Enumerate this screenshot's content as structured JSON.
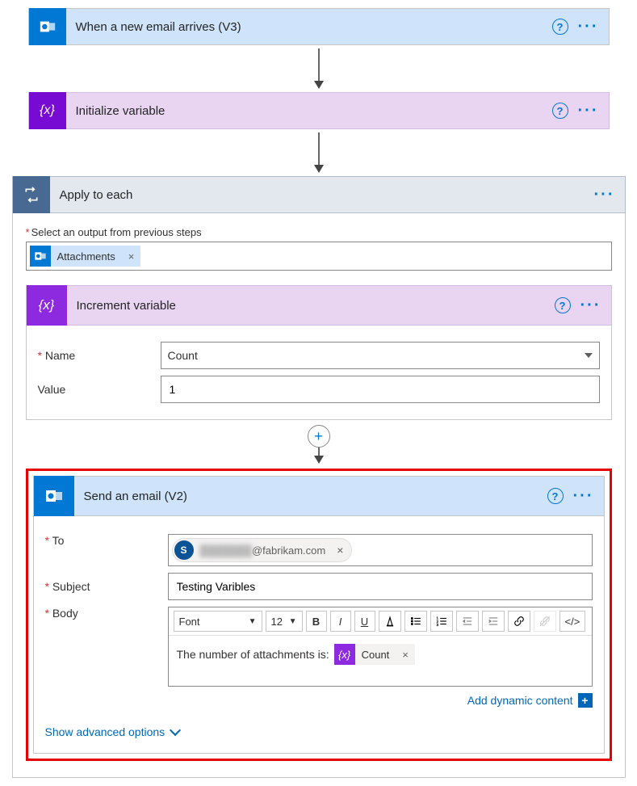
{
  "trigger": {
    "title": "When a new email arrives (V3)"
  },
  "init": {
    "title": "Initialize variable"
  },
  "apply": {
    "title": "Apply to each",
    "select_label": "Select an output from previous steps",
    "token_label": "Attachments"
  },
  "increment": {
    "title": "Increment variable",
    "name_label": "Name",
    "name_value": "Count",
    "value_label": "Value",
    "value_value": "1"
  },
  "send": {
    "title": "Send an email (V2)",
    "to_label": "To",
    "to_avatar": "S",
    "to_masked": "@fabrikam.com",
    "subject_label": "Subject",
    "subject_value": "Testing Varibles",
    "body_label": "Body",
    "font_label": "Font",
    "font_size": "12",
    "body_text": "The number of attachments is:",
    "body_token": "Count"
  },
  "links": {
    "dynamic": "Add dynamic content",
    "advanced": "Show advanced options"
  }
}
